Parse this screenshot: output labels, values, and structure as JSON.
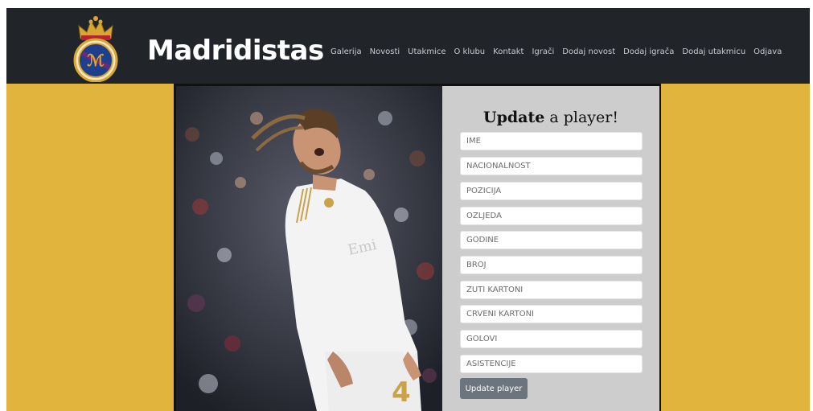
{
  "brand": {
    "title": "Madridistas"
  },
  "nav": {
    "links": [
      "Galerija",
      "Novosti",
      "Utakmice",
      "O klubu",
      "Kontakt",
      "Igrači",
      "Dodaj novost",
      "Dodaj igrača",
      "Dodaj utakmicu",
      "Odjava"
    ]
  },
  "form": {
    "title_bold": "Update",
    "title_rest": " a player!",
    "fields": [
      "IME",
      "NACIONALNOST",
      "POZICIJA",
      "OZLJEDA",
      "GODINE",
      "BROJ",
      "ŽUTI KARTONI",
      "CRVENI KARTONI",
      "GOLOVI",
      "ASISTENCIJE"
    ],
    "submit_label": "Update player"
  },
  "colors": {
    "navbar": "#212429",
    "page_background": "#e1b53d",
    "form_panel": "#cdcdcd",
    "button": "#6c757d"
  },
  "icons": {
    "logo": "real-madrid-crest-icon"
  }
}
